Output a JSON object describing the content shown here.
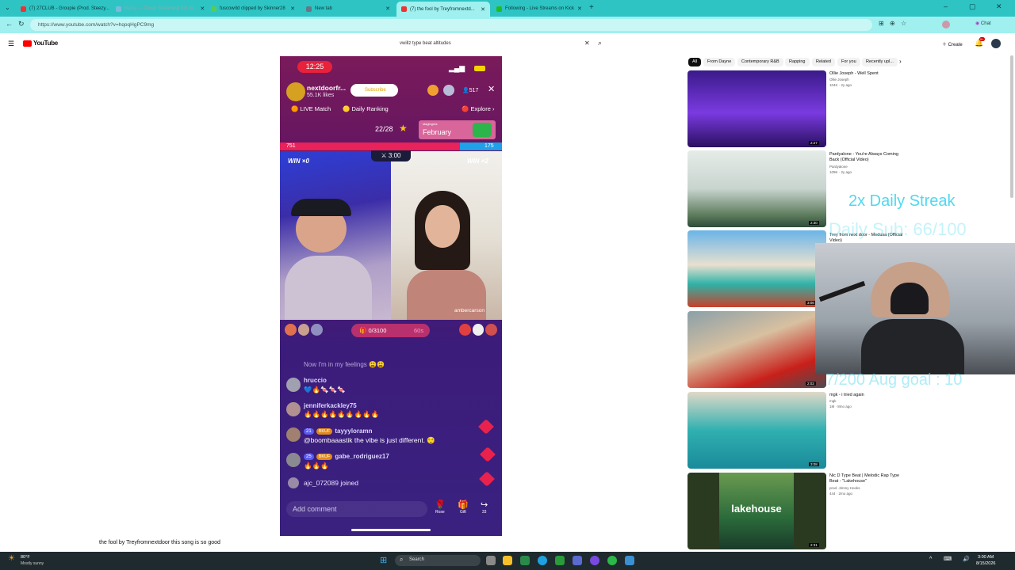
{
  "tabs": [
    {
      "label": "(7) 27CLUB - Groupie (Prod. Steezy...",
      "color": "#e33"
    },
    {
      "label": "Botify — Cloud Streaming Bot fo...",
      "color": "#7bd"
    },
    {
      "label": "fuscowrld clipped by Skinner28",
      "color": "#5c5"
    },
    {
      "label": "New tab",
      "color": "#678"
    },
    {
      "label": "(7) the fool by Treyfromnextd...",
      "color": "#e33"
    },
    {
      "label": "Following - Live Streams on Kick",
      "color": "#2b2"
    }
  ],
  "url": "https://www.youtube.com/watch?v=hqoqHgPC9mg",
  "chat_label": "Chat",
  "yt": {
    "logo": "YouTube",
    "search_value": "vwillz type beat altitudes",
    "create": "Create",
    "notif": "9+"
  },
  "tt": {
    "time": "12:25",
    "host": "nextdoorfr...",
    "likes": "55.1K likes",
    "subscribe": "Subscribe",
    "viewers": "517",
    "live_match": "LIVE Match",
    "daily_ranking": "Daily Ranking",
    "explore": "Explore",
    "rank": "22/28",
    "banner_small": "stagingma",
    "banner": "February",
    "score_left": "751",
    "score_right": "175",
    "win_left": "WIN ×0",
    "win_right": "WIN ×2",
    "timer": "3:00",
    "opponent": "ambercarson",
    "goal": "0/3100",
    "goal_time": "60s",
    "chat": [
      {
        "name": "",
        "msg": "Now I'm in my feelings 😩😩"
      },
      {
        "name": "hruccio",
        "msg": "💙🔥🍬🍬🍬"
      },
      {
        "name": "jenniferkackley75",
        "msg": "🔥🔥🔥🔥🔥🔥🔥🔥🔥"
      },
      {
        "name": "tayyyloramn",
        "badge": "21",
        "msg": "@boombaaastik the vibe is just different. 😌"
      },
      {
        "name": "gabe_rodriguez17",
        "badge": "25",
        "msg": "🔥🔥🔥"
      },
      {
        "name": "",
        "msg": "ajc_072089 joined"
      }
    ],
    "comment": "Add comment",
    "rose": "Rose",
    "gift": "Gift",
    "share": "33"
  },
  "chips": [
    "All",
    "From Dayne",
    "Contemporary R&B",
    "Rapping",
    "Related",
    "For you",
    "Recently upl..."
  ],
  "videos": [
    {
      "title": "Ollie Joseph - Well Spent",
      "channel": "Ollie Joseph",
      "meta": "104K · 2y ago",
      "dur": "2:27"
    },
    {
      "title": "Pardyalone - You're Always Coming Back (Official Video)",
      "channel": "Pardyalone",
      "meta": "109K · 2y ago",
      "dur": "2:30"
    },
    {
      "title": "Trey from next door - Medusa (Official Video)",
      "channel": "",
      "meta": "",
      "dur": "3:06"
    },
    {
      "title": "",
      "channel": "",
      "meta": "",
      "dur": "2:02"
    },
    {
      "title": "mgk - i tried again",
      "channel": "mgk",
      "meta": "1M · 8mo ago",
      "dur": "3:08"
    },
    {
      "title": "Nic D Type Beat | Melodic Rap Type Beat - \"Lakehouse\"",
      "channel": "prod. Jimmy Hooks",
      "meta": "444 · 2mo ago",
      "dur": "2:31"
    }
  ],
  "overlay": {
    "streak": "2x Daily Streak",
    "subgoal": "Daily Sub: 66/100",
    "auggoal": "7/200 Aug goal : 10"
  },
  "caption": "the fool by Treyfromnextdoor this song is so good",
  "taskbar": {
    "temp": "80°F",
    "weather": "Mostly sunny",
    "search": "Search",
    "time": "3:00 AM",
    "date": "8/15/2026"
  }
}
